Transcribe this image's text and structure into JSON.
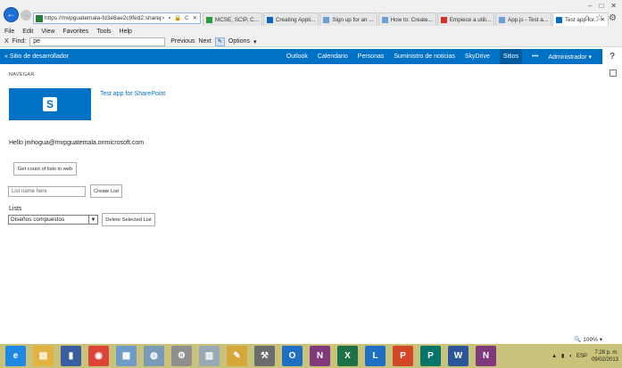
{
  "browser": {
    "address_url": "https://mvpguatemala-fd3e8ae2c9fed2.sharepoi...",
    "tabs": [
      {
        "label": "MCSE, SCIP, C...",
        "color": "#2a9a3b"
      },
      {
        "label": "Creating Appli...",
        "color": "#0a66c2"
      },
      {
        "label": "Sign up for an ...",
        "color": "#6a9fd8"
      },
      {
        "label": "How to: Create...",
        "color": "#6a9fd8"
      },
      {
        "label": "Empiece a utili...",
        "color": "#d93025"
      },
      {
        "label": "App.js - Test a...",
        "color": "#6a9fd8"
      },
      {
        "label": "Test app for...",
        "color": "#0072c6"
      }
    ],
    "menu": [
      "File",
      "Edit",
      "View",
      "Favorites",
      "Tools",
      "Help"
    ],
    "find": {
      "close": "X",
      "label": "Find:",
      "value": "pe",
      "previous": "Previous",
      "next": "Next",
      "options": "Options"
    }
  },
  "suitebar": {
    "site_link": "« Sitio de desarrollador",
    "links": [
      "Outlook",
      "Calendario",
      "Personas",
      "Suministro de noticias",
      "SkyDrive"
    ],
    "active_link": "Sitios",
    "more": "•••",
    "user": "Administrador ▾",
    "help": "?"
  },
  "page": {
    "navegar": "NAVEGAR",
    "app_title": "Test app for SharePoint",
    "hello": "Hello jmhogua@mvpguatemala.onmicrosoft.com",
    "get_count_button": "Get count of lists in web",
    "list_name_placeholder": "List name here",
    "create_list_button": "Create List",
    "lists_label": "Lists",
    "lists_selected": "Diseños compuestos",
    "delete_button": "Delete Selected List"
  },
  "status": {
    "zoom": "100%"
  },
  "taskbar": {
    "items": [
      {
        "name": "ie-icon",
        "color": "#1e88e5",
        "glyph": "e"
      },
      {
        "name": "file-explorer-icon",
        "color": "#e3b341",
        "glyph": "▤"
      },
      {
        "name": "dev-tools-icon",
        "color": "#3a5fa0",
        "glyph": "▮"
      },
      {
        "name": "chrome-icon",
        "color": "#db4437",
        "glyph": "◉"
      },
      {
        "name": "network-icon",
        "color": "#6f9bc9",
        "glyph": "▦"
      },
      {
        "name": "globe-icon",
        "color": "#7a9bb8",
        "glyph": "◍"
      },
      {
        "name": "gear-icon",
        "color": "#8f8f8f",
        "glyph": "⚙"
      },
      {
        "name": "document-icon",
        "color": "#9aa7b5",
        "glyph": "▥"
      },
      {
        "name": "paint-icon",
        "color": "#d6a83a",
        "glyph": "✎"
      },
      {
        "name": "tools-icon",
        "color": "#6c6c6c",
        "glyph": "⚒"
      },
      {
        "name": "outlook-icon",
        "color": "#1f6fc3",
        "glyph": "O"
      },
      {
        "name": "onenote-icon",
        "color": "#80397b",
        "glyph": "N"
      },
      {
        "name": "excel-icon",
        "color": "#1e7145",
        "glyph": "X"
      },
      {
        "name": "lync-icon",
        "color": "#1f6fc3",
        "glyph": "L"
      },
      {
        "name": "powerpoint-icon",
        "color": "#d24726",
        "glyph": "P"
      },
      {
        "name": "publisher-icon",
        "color": "#077568",
        "glyph": "P"
      },
      {
        "name": "word-icon",
        "color": "#2b579a",
        "glyph": "W"
      },
      {
        "name": "onenote-icon-2",
        "color": "#80397b",
        "glyph": "N"
      }
    ],
    "language": "ESP",
    "time": "7:28 p. m.",
    "date": "09/02/2013"
  },
  "colors": {
    "suitebar": "#0072c6",
    "taskbar": "#c9c27b"
  }
}
